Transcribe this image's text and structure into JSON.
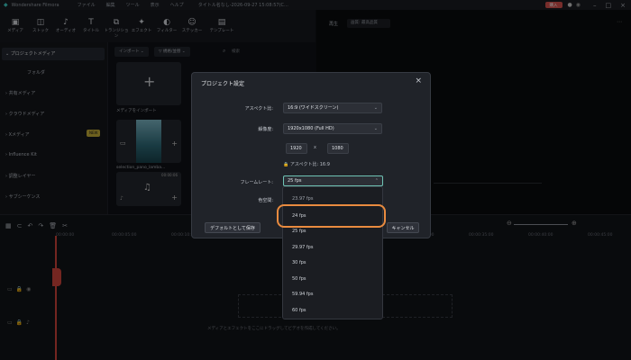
{
  "app": {
    "title": "Wondershare Filmora",
    "menu": [
      "ファイル",
      "編集",
      "ツール",
      "表示",
      "ヘルプ"
    ],
    "project_title": "タイトル名なし-2026-09-27 15:08:57(C...",
    "purchase": "購入"
  },
  "toolbar": {
    "items": [
      {
        "label": "メディア",
        "icon": "media-icon"
      },
      {
        "label": "ストック",
        "icon": "stock-icon"
      },
      {
        "label": "オーディオ",
        "icon": "audio-icon"
      },
      {
        "label": "タイトル",
        "icon": "title-icon"
      },
      {
        "label": "トランジション",
        "icon": "transition-icon"
      },
      {
        "label": "エフェクト",
        "icon": "effects-icon"
      },
      {
        "label": "フィルター",
        "icon": "filter-icon"
      },
      {
        "label": "ステッカー",
        "icon": "sticker-icon"
      },
      {
        "label": "テンプレート",
        "icon": "template-icon"
      }
    ]
  },
  "sidebar": {
    "items": [
      {
        "label": "プロジェクトメディア"
      },
      {
        "label": "フォルダ"
      },
      {
        "label": "共有メディア"
      },
      {
        "label": "クラウドメディア"
      },
      {
        "label": "Xメディア"
      },
      {
        "label": "Influence Kit"
      },
      {
        "label": "調整レイヤー"
      },
      {
        "label": "サブシーケンス"
      }
    ],
    "badge": "NEW"
  },
  "media": {
    "import_label": "インポート",
    "sort_label": "規格/並替",
    "search_placeholder": "検索",
    "import_tile_label": "メディアをインポート",
    "clip_label": "selection_pano_lamba...",
    "clip_duration": "00:00:06"
  },
  "preview": {
    "player_label": "再生",
    "quality": "画質: 最高品質"
  },
  "timeline": {
    "ruler": [
      "00:00:00",
      "00:00:05:00",
      "00:00:10:00",
      "00:00:15:00",
      "00:00:20:00",
      "00:00:25:00",
      "00:00:30:00",
      "00:00:35:00",
      "00:00:40:00",
      "00:00:45:00"
    ],
    "hint": "メディアとエフェクトをここにドラッグしてビデオを作成してください。"
  },
  "dialog": {
    "title": "プロジェクト設定",
    "aspect_label": "アスペクト比:",
    "aspect_value": "16:9 (ワイドスクリーン)",
    "resolution_label": "解像度:",
    "resolution_value": "1920x1080 (Full HD)",
    "width": "1920",
    "x_sep": "x",
    "height": "1080",
    "lock_text": "アスペクト比: 16:9",
    "framerate_label": "フレームレート:",
    "framerate_value": "25 fps",
    "colorspace_label": "色空間:",
    "default_button": "デフォルトとして保存",
    "cancel_button": "キャンセル"
  },
  "framerate_options": [
    "23.97 fps",
    "24 fps",
    "25 fps",
    "29.97 fps",
    "30 fps",
    "50 fps",
    "59.94 fps",
    "60 fps"
  ],
  "colors": {
    "highlight": "#e98b3f",
    "purchase": "#d9534f",
    "badge": "#c9b13a"
  }
}
